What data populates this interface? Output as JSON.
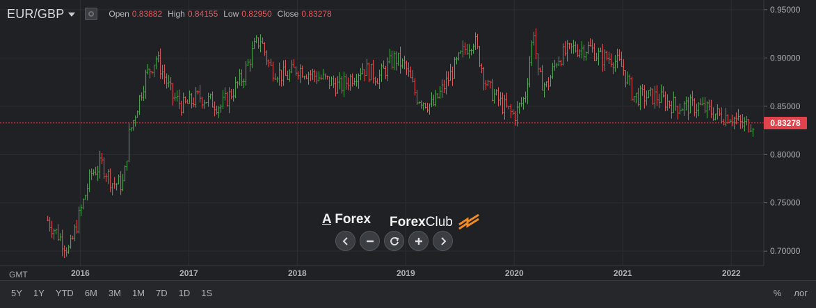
{
  "header": {
    "symbol": "EUR/GBP",
    "open_label": "Open",
    "open_value": "0.83882",
    "high_label": "High",
    "high_value": "0.84155",
    "low_label": "Low",
    "low_value": "0.82950",
    "close_label": "Close",
    "close_value": "0.83278"
  },
  "last_price_tag": "0.83278",
  "timezone_label": "GMT",
  "ranges": [
    "5Y",
    "1Y",
    "YTD",
    "6M",
    "3M",
    "1M",
    "7D",
    "1D",
    "1S"
  ],
  "bottom_right": {
    "percent": "%",
    "log": "лог"
  },
  "branding": {
    "logo_a": "A",
    "logo_forex": "Forex",
    "logo_club_bold": "Forex",
    "logo_club": "Club"
  },
  "colors": {
    "up": "#4caf50",
    "down": "#e8575a",
    "last_price": "#e0434b",
    "background": "#1f2124",
    "grid": "#2c2f33"
  },
  "chart_data": {
    "type": "candlestick",
    "symbol": "EUR/GBP",
    "y_ticks": [
      0.7,
      0.75,
      0.8,
      0.85,
      0.9,
      0.95
    ],
    "ylim": [
      0.685,
      0.96
    ],
    "x_tick_labels": [
      "2016",
      "2017",
      "2018",
      "2019",
      "2020",
      "2021",
      "2022"
    ],
    "x": [
      2015.7,
      2015.9,
      2016.0,
      2016.1,
      2016.2,
      2016.3,
      2016.4,
      2016.45,
      2016.5,
      2016.55,
      2016.6,
      2016.7,
      2016.78,
      2016.85,
      2016.95,
      2017.1,
      2017.3,
      2017.5,
      2017.6,
      2017.66,
      2017.75,
      2017.9,
      2018.0,
      2018.2,
      2018.4,
      2018.6,
      2018.75,
      2018.9,
      2019.0,
      2019.1,
      2019.25,
      2019.4,
      2019.55,
      2019.63,
      2019.75,
      2019.9,
      2020.0,
      2020.1,
      2020.18,
      2020.22,
      2020.3,
      2020.4,
      2020.55,
      2020.7,
      2020.8,
      2020.9,
      2021.0,
      2021.1,
      2021.2,
      2021.3,
      2021.5,
      2021.7,
      2021.9,
      2022.0,
      2022.1,
      2022.2
    ],
    "close": [
      0.732,
      0.7,
      0.74,
      0.78,
      0.79,
      0.77,
      0.77,
      0.82,
      0.84,
      0.86,
      0.88,
      0.9,
      0.88,
      0.86,
      0.85,
      0.86,
      0.85,
      0.88,
      0.91,
      0.92,
      0.89,
      0.88,
      0.89,
      0.88,
      0.87,
      0.89,
      0.88,
      0.9,
      0.89,
      0.86,
      0.85,
      0.88,
      0.91,
      0.92,
      0.87,
      0.85,
      0.84,
      0.86,
      0.93,
      0.88,
      0.87,
      0.9,
      0.91,
      0.91,
      0.9,
      0.9,
      0.89,
      0.86,
      0.86,
      0.86,
      0.85,
      0.85,
      0.84,
      0.84,
      0.83,
      0.833
    ]
  }
}
